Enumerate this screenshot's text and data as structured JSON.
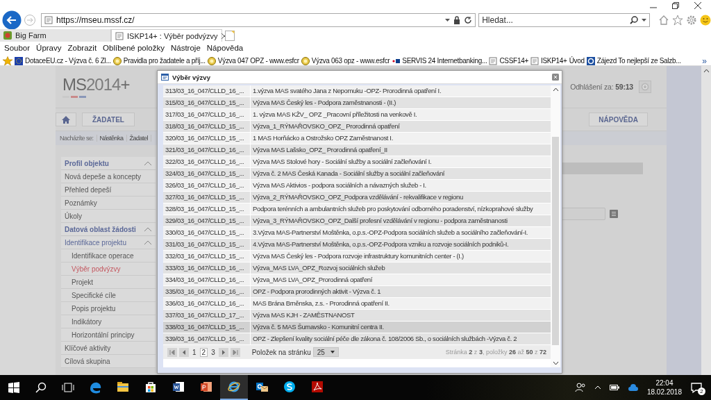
{
  "browser": {
    "address": "https://mseu.mssf.cz/",
    "search_placeholder": "Hledat...",
    "tabs": [
      {
        "label": "Big Farm",
        "selected": false
      },
      {
        "label": "ISKP14+ : Výběr podvýzvy",
        "selected": true
      }
    ],
    "menu": [
      "Soubor",
      "Úpravy",
      "Zobrazit",
      "Oblíbené položky",
      "Nástroje",
      "Nápověda"
    ],
    "favorites": [
      {
        "label": "DotaceEU.cz - Výzva č. 6 Zl...",
        "kind": "eu"
      },
      {
        "label": "Pravidla pro žadatele a příj...",
        "kind": "seal"
      },
      {
        "label": "Výzva 047 OPZ - www.esfcr",
        "kind": "seal"
      },
      {
        "label": "Výzva 063 opz - www.esfcr",
        "kind": "seal"
      },
      {
        "label": "SERVIS 24 Internetbanking...",
        "kind": "bank"
      },
      {
        "label": "CSSF14+",
        "kind": "page"
      },
      {
        "label": "ISKP14+",
        "kind": "page"
      },
      {
        "label": "Úvod",
        "kind": "plain"
      },
      {
        "label": "Zájezd  To nejlepší ze Salzb...",
        "kind": "ring"
      }
    ],
    "favorites_more": "»"
  },
  "page": {
    "logo": "**MS**2014**+**",
    "logout_label": "Odhlášení za:",
    "logout_time": "59:13",
    "role_button": "ŽADATEL",
    "help_button": "NÁPOVĚDA",
    "breadcrumb_label": "Nacházíte se:",
    "breadcrumb": [
      "Nástěnka",
      "Žadatel"
    ],
    "sidebar": [
      {
        "title": "Profil objektu",
        "expanded": true,
        "items": [
          {
            "label": "Nová depeše a koncepty",
            "selected": false
          },
          {
            "label": "Přehled depeší",
            "selected": false
          },
          {
            "label": "Poznámky",
            "selected": false
          },
          {
            "label": "Úkoly",
            "selected": false
          }
        ]
      },
      {
        "title": "Datová oblast žádosti",
        "expanded": true,
        "items": [
          {
            "label": "Identifikace projektu",
            "selected": false,
            "expanded": true,
            "children": [
              {
                "label": "Identifikace operace",
                "selected": false
              },
              {
                "label": "Výběr podvýzvy",
                "selected": true
              },
              {
                "label": "Projekt",
                "selected": false
              },
              {
                "label": "Specifické cíle",
                "selected": false
              },
              {
                "label": "Popis projektu",
                "selected": false
              },
              {
                "label": "Indikátory",
                "selected": false
              },
              {
                "label": "Horizontální principy",
                "selected": false
              }
            ]
          },
          {
            "label": "Klíčové aktivity",
            "selected": false
          },
          {
            "label": "Cílová skupina",
            "selected": false
          }
        ]
      }
    ]
  },
  "dialog": {
    "title": "Výběr výzvy",
    "rows": [
      {
        "code": "313/03_16_047/CLLD_16_...",
        "name": "1.výzva MAS svatého Jana z Nepomuku -OPZ- Prorodinná opatření I.",
        "selected": false
      },
      {
        "code": "315/03_16_047/CLLD_15_...",
        "name": "Výzva MAS Český les - Podpora zaměstnanosti - (II.)",
        "selected": false
      },
      {
        "code": "317/03_16_047/CLLD_16_...",
        "name": "1. výzva MAS KŽV_ OPZ _Pracovní příležitosti na venkově I.",
        "selected": false
      },
      {
        "code": "318/03_16_047/CLLD_15_...",
        "name": "Výzva_1_RÝMAŘOVSKO_OPZ_ Prorodinná opatření",
        "selected": false
      },
      {
        "code": "320/03_16_047/CLLD_15_...",
        "name": "1 MAS Horňácko a Ostrožsko OPZ Zaměstnanost I.",
        "selected": false
      },
      {
        "code": "321/03_16_047/CLLD_16_...",
        "name": "Výzva MAS Lašsko_OPZ_ Prorodinná opatření_II",
        "selected": false
      },
      {
        "code": "322/03_16_047/CLLD_16_...",
        "name": "Výzva MAS Stolové hory - Sociální služby a sociální začleňování I.",
        "selected": false
      },
      {
        "code": "324/03_16_047/CLLD_15_...",
        "name": "Výzva č. 2 MAS Česká Kanada - Sociální služby a sociální začleňování",
        "selected": false
      },
      {
        "code": "326/03_16_047/CLLD_16_...",
        "name": "Výzva MAS Aktivios - podpora sociálních a návazných služeb - I.",
        "selected": false
      },
      {
        "code": "327/03_16_047/CLLD_15_...",
        "name": "Výzva_2_RÝMAŘOVSKO_OPZ_Podpora vzdělávání - rekvalifikace v regionu",
        "selected": false
      },
      {
        "code": "328/03_16_047/CLLD_15_...",
        "name": "Podpora terénních a ambulantních služeb pro poskytování odborného poradenství, nízkoprahové služby",
        "selected": false
      },
      {
        "code": "329/03_16_047/CLLD_15_...",
        "name": "Výzva_3_RÝMAŘOVSKO_OPZ_Další profesní vzdělávání v regionu - podpora zaměstnanosti",
        "selected": false
      },
      {
        "code": "330/03_16_047/CLLD_15_...",
        "name": "3.Výzva MAS-Partnerství Moštěnka, o.p.s.-OPZ-Podpora sociálních služeb a sociálního začleňování-I.",
        "selected": false
      },
      {
        "code": "331/03_16_047/CLLD_15_...",
        "name": "4.Výzva MAS-Partnerství Moštěnka, o.p.s.-OPZ-Podpora vzniku a rozvoje sociálních podniků-I.",
        "selected": false
      },
      {
        "code": "332/03_16_047/CLLD_15_...",
        "name": "Výzva MAS Český les - Podpora rozvoje infrastruktury komunitních center - (I.)",
        "selected": false
      },
      {
        "code": "333/03_16_047/CLLD_16_...",
        "name": "Výzva_MAS LVA_OPZ_Rozvoj sociálních služeb",
        "selected": false
      },
      {
        "code": "334/03_16_047/CLLD_16_...",
        "name": "Výzva_MAS LVA_OPZ_Prorodinná opatření",
        "selected": false
      },
      {
        "code": "335/03_16_047/CLLD_16_...",
        "name": "OPZ - Podpora prorodinných aktivit - Výzva č. 1",
        "selected": false
      },
      {
        "code": "336/03_16_047/CLLD_16_...",
        "name": "MAS Brána Brněnska, z.s. - Prorodinná opatření II.",
        "selected": false
      },
      {
        "code": "337/03_16_047/CLLD_17_...",
        "name": "Výzva MAS KJH - ZAMĚSTNANOST",
        "selected": false
      },
      {
        "code": "338/03_16_047/CLLD_15_...",
        "name": "Výzva č. 5 MAS Šumavsko - Komunitní centra II.",
        "selected": true
      },
      {
        "code": "339/03_16_047/CLLD_16_...",
        "name": "OPZ - Zlepšení kvality sociální péče dle zákona č. 108/2006 Sb., o sociálních službách -Výzva č. 2",
        "selected": false
      }
    ],
    "pager": {
      "pages": [
        {
          "label": "1",
          "selected": false
        },
        {
          "label": "2",
          "selected": true
        },
        {
          "label": "3",
          "selected": false
        }
      ],
      "page_size_label": "Položek na stránku",
      "page_size": "25",
      "summary": "Stránka **2** z **3**, položky **26** až **50** z **72**"
    }
  },
  "taskbar": {
    "apps": [
      {
        "kind": "edge",
        "active": false
      },
      {
        "kind": "explorer",
        "active": false
      },
      {
        "kind": "store",
        "active": false
      },
      {
        "kind": "word",
        "active": false
      },
      {
        "kind": "powerpoint",
        "active": false
      },
      {
        "kind": "ie",
        "active": true
      },
      {
        "kind": "outlook",
        "active": false
      },
      {
        "kind": "skype",
        "active": false
      },
      {
        "kind": "acrobat",
        "active": false
      }
    ],
    "time": "22:04",
    "date": "18.02.2018",
    "notifications": "2"
  }
}
